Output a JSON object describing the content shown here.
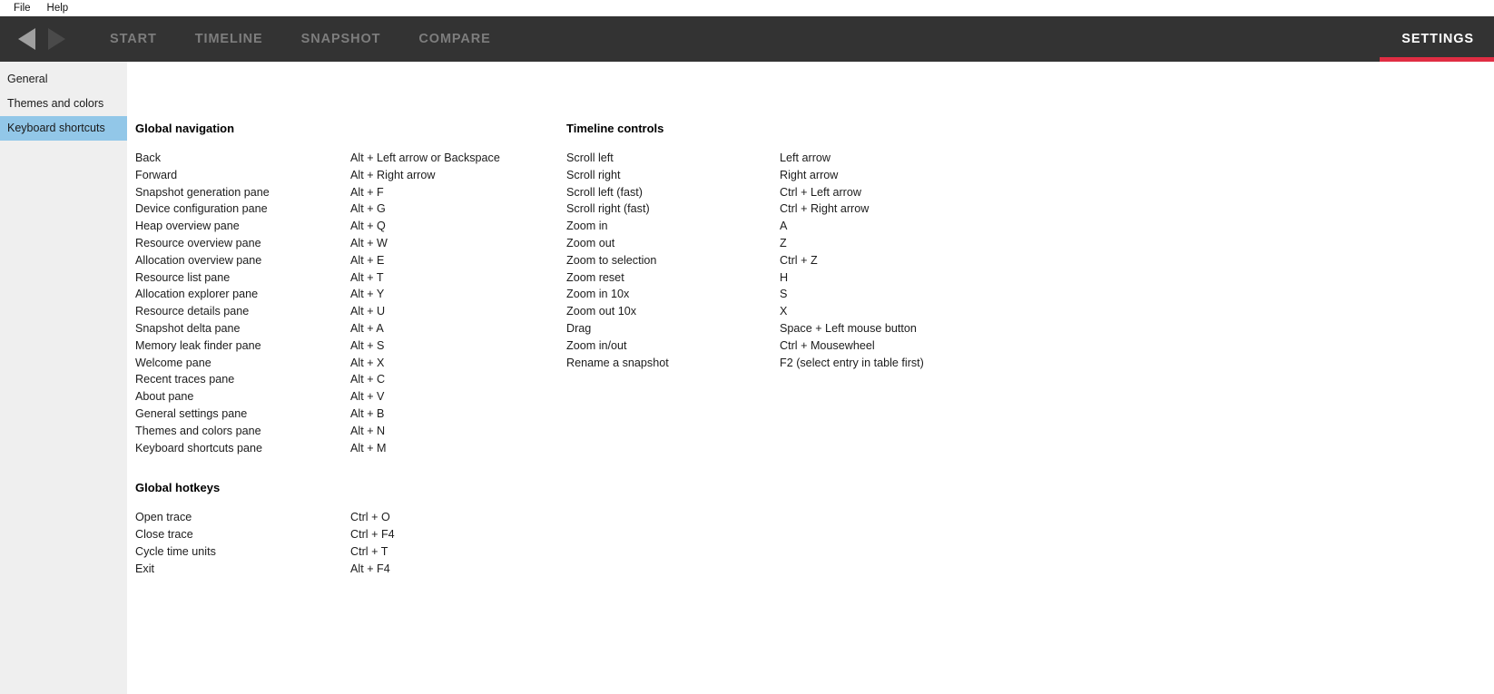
{
  "menubar": {
    "items": [
      {
        "label": "File",
        "name": "menu-file"
      },
      {
        "label": "Help",
        "name": "menu-help"
      }
    ]
  },
  "header": {
    "back_icon": "arrow-left-icon",
    "forward_icon": "arrow-right-icon",
    "tabs": [
      {
        "label": "START",
        "active": false
      },
      {
        "label": "TIMELINE",
        "active": false
      },
      {
        "label": "SNAPSHOT",
        "active": false
      },
      {
        "label": "COMPARE",
        "active": false
      }
    ],
    "settings_tab": {
      "label": "SETTINGS",
      "active": true
    },
    "colors": {
      "bar_background": "#333333",
      "tab_inactive": "#7d7d7d",
      "tab_active": "#ffffff",
      "active_underline": "#e02d43"
    }
  },
  "sidebar": {
    "items": [
      {
        "label": "General",
        "selected": false
      },
      {
        "label": "Themes and colors",
        "selected": false
      },
      {
        "label": "Keyboard shortcuts",
        "selected": true
      }
    ],
    "colors": {
      "background": "#efefef",
      "selected": "#92c7e8"
    }
  },
  "main": {
    "left_column": [
      {
        "title": "Global navigation",
        "rows": [
          {
            "action": "Back",
            "shortcut": "Alt + Left arrow or Backspace"
          },
          {
            "action": "Forward",
            "shortcut": "Alt + Right arrow"
          },
          {
            "action": "Snapshot generation pane",
            "shortcut": "Alt + F"
          },
          {
            "action": "Device configuration pane",
            "shortcut": "Alt + G"
          },
          {
            "action": "Heap overview pane",
            "shortcut": "Alt + Q"
          },
          {
            "action": "Resource overview pane",
            "shortcut": "Alt + W"
          },
          {
            "action": "Allocation overview pane",
            "shortcut": "Alt + E"
          },
          {
            "action": "Resource list pane",
            "shortcut": "Alt + T"
          },
          {
            "action": "Allocation explorer pane",
            "shortcut": "Alt + Y"
          },
          {
            "action": "Resource details pane",
            "shortcut": "Alt + U"
          },
          {
            "action": "Snapshot delta pane",
            "shortcut": "Alt + A"
          },
          {
            "action": "Memory leak finder pane",
            "shortcut": "Alt + S"
          },
          {
            "action": "Welcome pane",
            "shortcut": "Alt + X"
          },
          {
            "action": "Recent traces pane",
            "shortcut": "Alt + C"
          },
          {
            "action": "About pane",
            "shortcut": "Alt + V"
          },
          {
            "action": "General settings pane",
            "shortcut": "Alt + B"
          },
          {
            "action": "Themes and colors pane",
            "shortcut": "Alt + N"
          },
          {
            "action": "Keyboard shortcuts pane",
            "shortcut": "Alt + M"
          }
        ]
      },
      {
        "title": "Global hotkeys",
        "rows": [
          {
            "action": "Open trace",
            "shortcut": "Ctrl + O"
          },
          {
            "action": "Close trace",
            "shortcut": "Ctrl + F4"
          },
          {
            "action": "Cycle time units",
            "shortcut": "Ctrl + T"
          },
          {
            "action": "Exit",
            "shortcut": "Alt + F4"
          }
        ]
      }
    ],
    "right_column": [
      {
        "title": "Timeline controls",
        "rows": [
          {
            "action": "Scroll left",
            "shortcut": "Left arrow"
          },
          {
            "action": "Scroll right",
            "shortcut": "Right arrow"
          },
          {
            "action": "Scroll left (fast)",
            "shortcut": "Ctrl + Left arrow"
          },
          {
            "action": "Scroll right (fast)",
            "shortcut": "Ctrl + Right arrow"
          },
          {
            "action": "Zoom in",
            "shortcut": "A"
          },
          {
            "action": "Zoom out",
            "shortcut": "Z"
          },
          {
            "action": "Zoom to selection",
            "shortcut": "Ctrl + Z"
          },
          {
            "action": "Zoom reset",
            "shortcut": "H"
          },
          {
            "action": "Zoom in 10x",
            "shortcut": "S"
          },
          {
            "action": "Zoom out 10x",
            "shortcut": "X"
          },
          {
            "action": "Drag",
            "shortcut": "Space + Left mouse button"
          },
          {
            "action": "Zoom in/out",
            "shortcut": "Ctrl + Mousewheel"
          },
          {
            "action": "Rename a snapshot",
            "shortcut": "F2 (select entry in table first)"
          }
        ]
      }
    ]
  }
}
